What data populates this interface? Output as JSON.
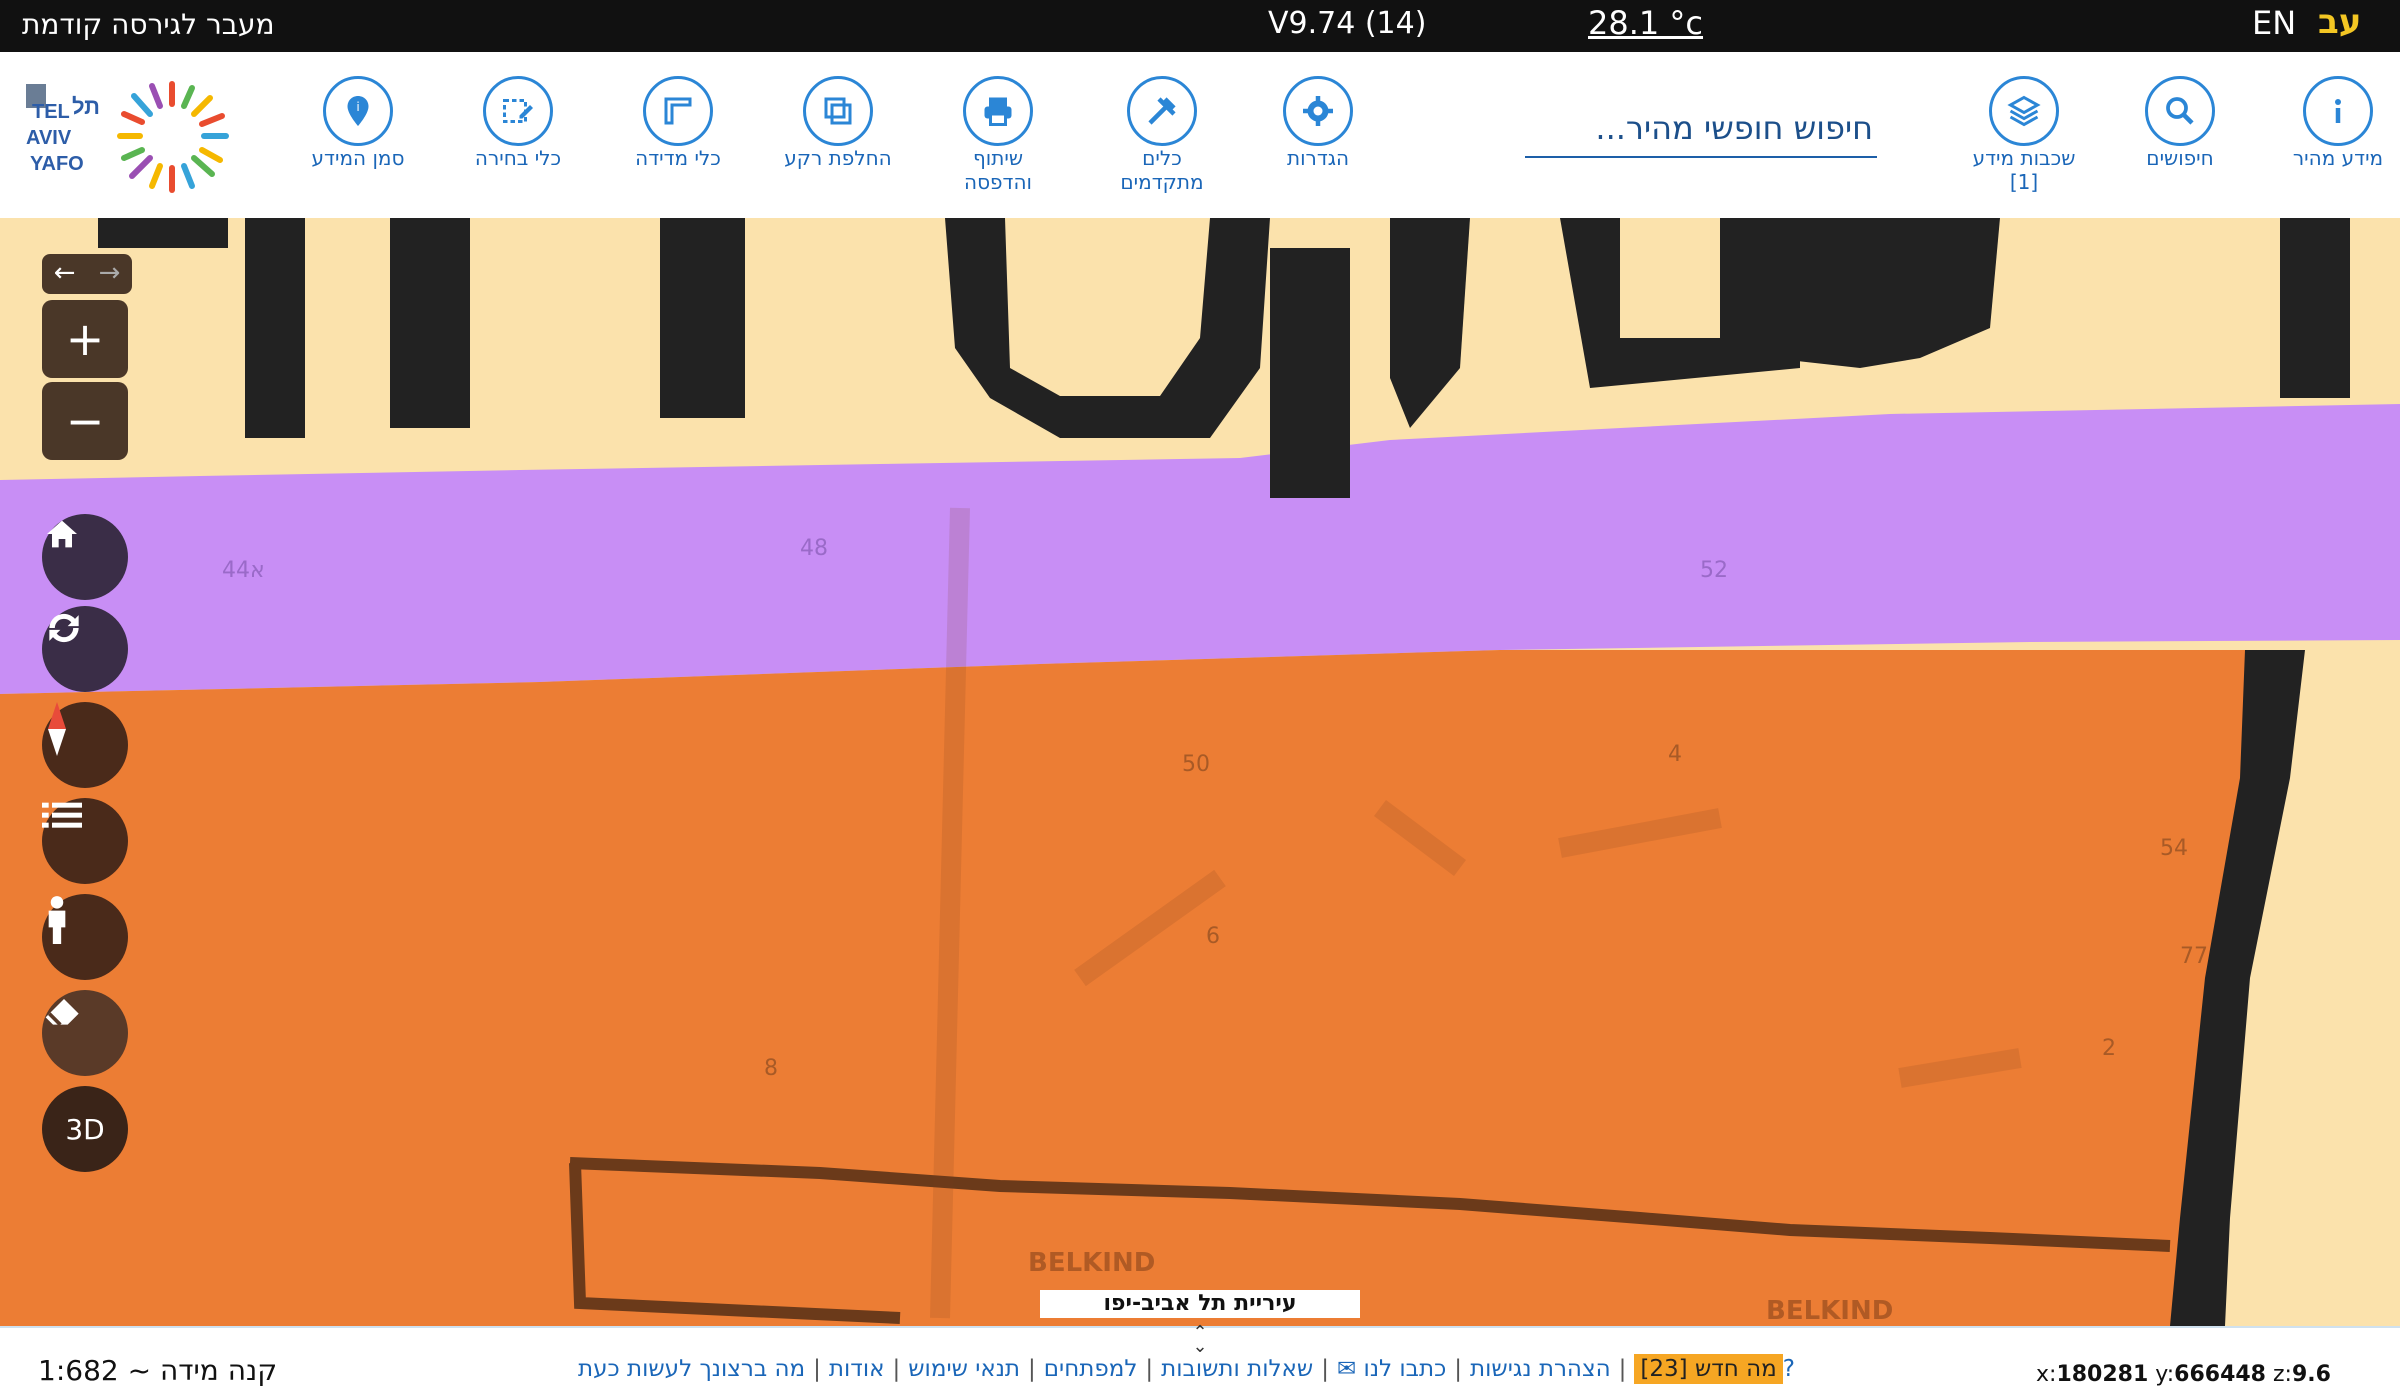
{
  "topbar": {
    "prev_version": "מעבר לגירסה קודמת",
    "version": "V9.74 (14)",
    "temperature": "28.1 °c",
    "lang_en": "EN",
    "lang_he": "עב"
  },
  "logo": {
    "text_en_1": "TEL",
    "text_en_2": "AVIV",
    "text_en_3": "YAFO",
    "text_he": "תל אביב יפו"
  },
  "tools": {
    "mark_info": "סמן המידע",
    "selection": "כלי בחירה",
    "measure": "כלי מדידה",
    "basemap": "החלפת רקע",
    "share_1": "שיתוף",
    "share_2": "והדפסה",
    "advanced_1": "כלים",
    "advanced_2": "מתקדמים",
    "settings": "הגדרות",
    "layers_1": "שכבות מידע",
    "layers_2": "[1]",
    "searches": "חיפושים",
    "quick_info": "מידע מהיר"
  },
  "search": {
    "placeholder": "חיפוש חופשי מהיר..."
  },
  "map": {
    "controls": {
      "three_d": "3D"
    },
    "labels": {
      "n44": "44א",
      "n48": "48",
      "n52": "52",
      "n50": "50",
      "n4": "4",
      "n54": "54",
      "n6": "6",
      "n77": "77",
      "n2": "2",
      "n8": "8",
      "belkind1": "BELKIND",
      "belkind2": "BELKIND"
    },
    "city_badge": "עיריית תל אביב-יפו",
    "colors": {
      "purple": "#c88ef5",
      "orange": "#ec7d34",
      "sand": "#fbe2ac",
      "dark": "#222222"
    }
  },
  "statusbar": {
    "scale": "קנה מידה ~ 1:682",
    "links": {
      "whats_new": "מה חדש [23]",
      "accessibility": "הצהרת נגישות",
      "write_us": "כתבו לנו ✉",
      "faq": "שאלות ותשובות",
      "developers": "למפתחים",
      "terms": "תנאי שימוש",
      "about": "אודות",
      "what_now": "מה ברצונך לעשות כעת?"
    },
    "coords": {
      "x_label": "x:",
      "x": "180281",
      "y_label": "y:",
      "y": "666448",
      "z_label": "z:",
      "z": "9.6"
    }
  }
}
